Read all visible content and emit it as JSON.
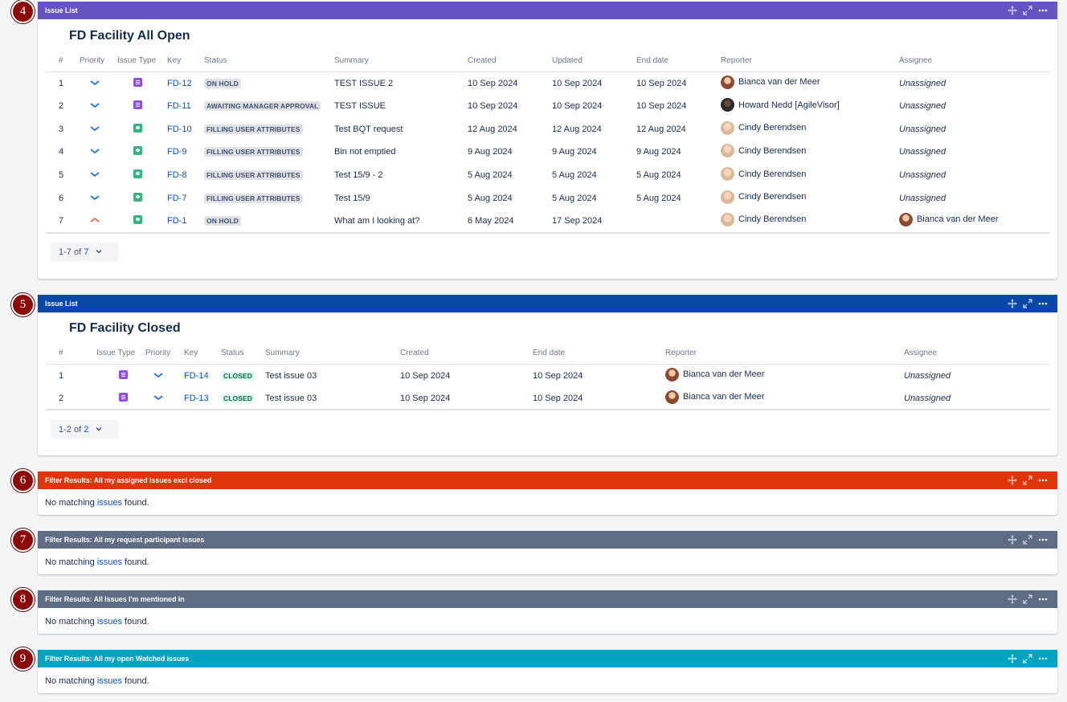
{
  "colors": {
    "header_purple": "#6554c0",
    "header_blue": "#0747a6",
    "header_red": "#de350b",
    "header_slate": "#5e6c84",
    "header_teal": "#00a3bf",
    "marker": "#8b0a0a",
    "link": "#0052cc"
  },
  "gadget4": {
    "marker": "4",
    "header": "Issue List",
    "title": "FD Facility All Open",
    "columns": [
      "#",
      "Priority",
      "Issue Type",
      "Key",
      "Status",
      "Summary",
      "Created",
      "Updated",
      "End date",
      "Reporter",
      "Assignee"
    ],
    "rows": [
      {
        "num": "1",
        "priority": "low",
        "type": "purple",
        "key": "FD-12",
        "status": "ON HOLD",
        "summary": "TEST ISSUE 2",
        "created": "10 Sep 2024",
        "updated": "10 Sep 2024",
        "end": "10 Sep 2024",
        "reporter": "Bianca van der Meer",
        "reporter_av": "bianca",
        "assignee": "Unassigned",
        "assignee_av": ""
      },
      {
        "num": "2",
        "priority": "low",
        "type": "purple",
        "key": "FD-11",
        "status": "AWAITING MANAGER APPROVAL",
        "summary": "TEST ISSUE",
        "created": "10 Sep 2024",
        "updated": "10 Sep 2024",
        "end": "10 Sep 2024",
        "reporter": "Howard Nedd [AgileVisor]",
        "reporter_av": "howard",
        "assignee": "Unassigned",
        "assignee_av": ""
      },
      {
        "num": "3",
        "priority": "low",
        "type": "green",
        "key": "FD-10",
        "status": "FILLING USER ATTRIBUTES",
        "summary": "Test BQT request",
        "created": "12 Aug 2024",
        "updated": "12 Aug 2024",
        "end": "12 Aug 2024",
        "reporter": "Cindy Berendsen",
        "reporter_av": "cindy",
        "assignee": "Unassigned",
        "assignee_av": ""
      },
      {
        "num": "4",
        "priority": "low",
        "type": "green",
        "key": "FD-9",
        "status": "FILLING USER ATTRIBUTES",
        "summary": "Bin not emptied",
        "created": "9 Aug 2024",
        "updated": "9 Aug 2024",
        "end": "9 Aug 2024",
        "reporter": "Cindy Berendsen",
        "reporter_av": "cindy",
        "assignee": "Unassigned",
        "assignee_av": ""
      },
      {
        "num": "5",
        "priority": "low",
        "type": "green",
        "key": "FD-8",
        "status": "FILLING USER ATTRIBUTES",
        "summary": "Test 15/9 - 2",
        "created": "5 Aug 2024",
        "updated": "5 Aug 2024",
        "end": "5 Aug 2024",
        "reporter": "Cindy Berendsen",
        "reporter_av": "cindy",
        "assignee": "Unassigned",
        "assignee_av": ""
      },
      {
        "num": "6",
        "priority": "low",
        "type": "green",
        "key": "FD-7",
        "status": "FILLING USER ATTRIBUTES",
        "summary": "Test 15/9",
        "created": "5 Aug 2024",
        "updated": "5 Aug 2024",
        "end": "5 Aug 2024",
        "reporter": "Cindy Berendsen",
        "reporter_av": "cindy",
        "assignee": "Unassigned",
        "assignee_av": ""
      },
      {
        "num": "7",
        "priority": "high",
        "type": "green",
        "key": "FD-1",
        "status": "ON HOLD",
        "summary": "What am I looking at?",
        "created": "6 May 2024",
        "updated": "17 Sep 2024",
        "end": "",
        "reporter": "Cindy Berendsen",
        "reporter_av": "cindy",
        "assignee": "Bianca van der Meer",
        "assignee_av": "bianca"
      }
    ],
    "pager_range": "1-7 of",
    "pager_total": "7"
  },
  "gadget5": {
    "marker": "5",
    "header": "Issue List",
    "title": "FD Facility Closed",
    "columns": [
      "#",
      "Issue Type",
      "Priority",
      "Key",
      "Status",
      "Summary",
      "Created",
      "End date",
      "Reporter",
      "Assignee"
    ],
    "rows": [
      {
        "num": "1",
        "type": "purple",
        "priority": "low",
        "key": "FD-14",
        "status": "CLOSED",
        "summary": "Test issue 03",
        "created": "10 Sep 2024",
        "end": "10 Sep 2024",
        "reporter": "Bianca van der Meer",
        "assignee": "Unassigned"
      },
      {
        "num": "2",
        "type": "purple",
        "priority": "low",
        "key": "FD-13",
        "status": "CLOSED",
        "summary": "Test issue 03",
        "created": "10 Sep 2024",
        "end": "10 Sep 2024",
        "reporter": "Bianca van der Meer",
        "assignee": "Unassigned"
      }
    ],
    "pager_range": "1-2 of",
    "pager_total": "2"
  },
  "filters": [
    {
      "marker": "6",
      "header": "Filter Results: All my assigned issues excl closed",
      "color": "red"
    },
    {
      "marker": "7",
      "header": "Filter Results: All my request participant issues",
      "color": "slate"
    },
    {
      "marker": "8",
      "header": "Filter Results: All Issues I'm mentioned in",
      "color": "slate"
    },
    {
      "marker": "9",
      "header": "Filter Results: All my open Watched issues",
      "color": "teal"
    }
  ],
  "no_match": {
    "before": "No matching ",
    "link": "issues",
    "after": " found."
  },
  "icons": {
    "move": "move-icon",
    "expand": "expand-icon",
    "more": "more-icon"
  }
}
